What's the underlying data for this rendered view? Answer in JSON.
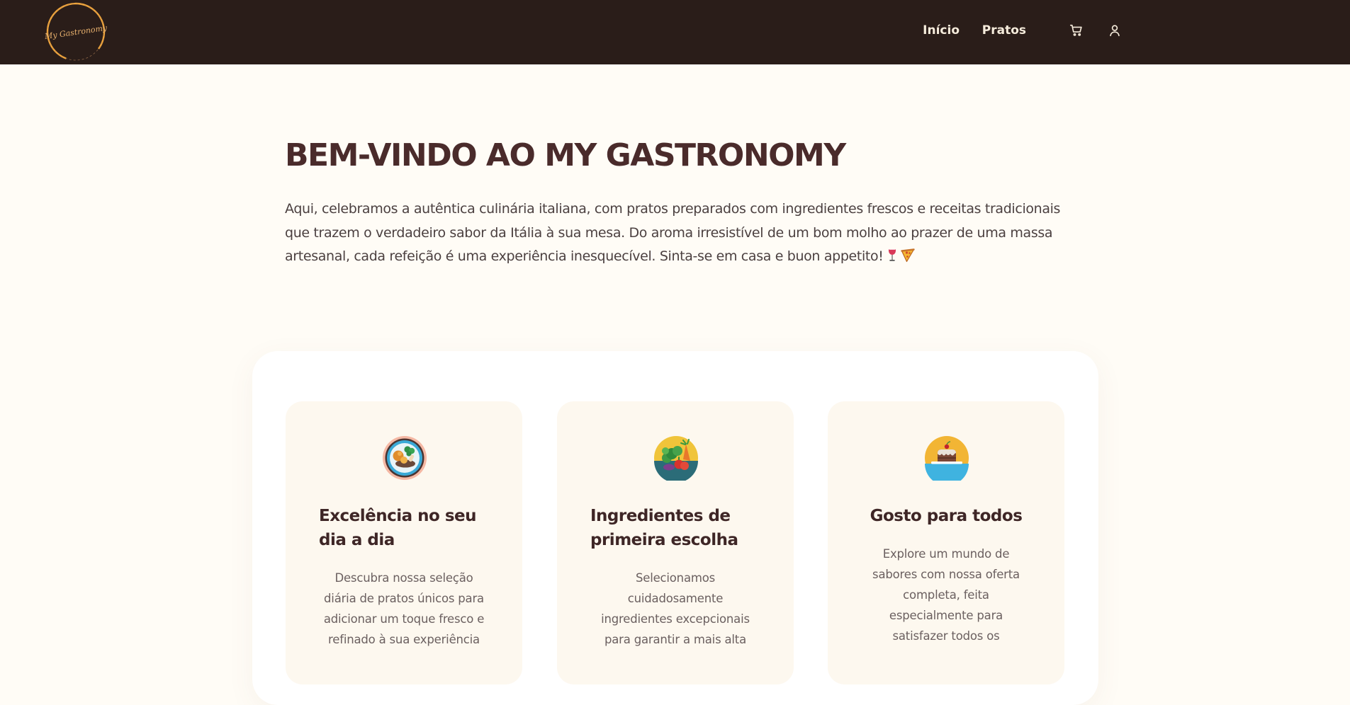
{
  "brand": {
    "logo_text": "My Gastronomy"
  },
  "nav": {
    "items": [
      {
        "label": "Início"
      },
      {
        "label": "Pratos"
      }
    ],
    "icons": [
      "cart-icon",
      "user-icon"
    ]
  },
  "hero": {
    "title": "BEM-VINDO AO MY GASTRONOMY",
    "text": "Aqui, celebramos a autêntica culinária italiana, com pratos preparados com ingredientes frescos e receitas tradicionais que trazem o verdadeiro sabor da Itália à sua mesa. Do aroma irresistível de um bom molho ao prazer de uma massa artesanal, cada refeição é uma experiência inesquecível. Sinta-se em casa e buon appetito!",
    "emoji": [
      "wine-glass-icon",
      "pizza-icon"
    ]
  },
  "features": [
    {
      "icon": "meal-plate-icon",
      "title": "Excelência no seu dia a dia",
      "text": "Descubra nossa seleção diária de pratos únicos para adicionar um toque fresco e refinado à sua experiência"
    },
    {
      "icon": "vegetables-icon",
      "title": "Ingredientes de primeira escolha",
      "text": "Selecionamos cuidadosamente ingredientes excepcionais para garantir a mais alta"
    },
    {
      "icon": "cake-icon",
      "title": "Gosto para todos",
      "text": "Explore um mundo de sabores com nossa oferta completa, feita especialmente para satisfazer todos os"
    }
  ],
  "colors": {
    "header_bg": "#2a1d19",
    "page_bg": "#fffcf6",
    "title": "#4a2b2b",
    "card_bg": "#fdf8ef",
    "logo_accent": "#f0a53a"
  }
}
